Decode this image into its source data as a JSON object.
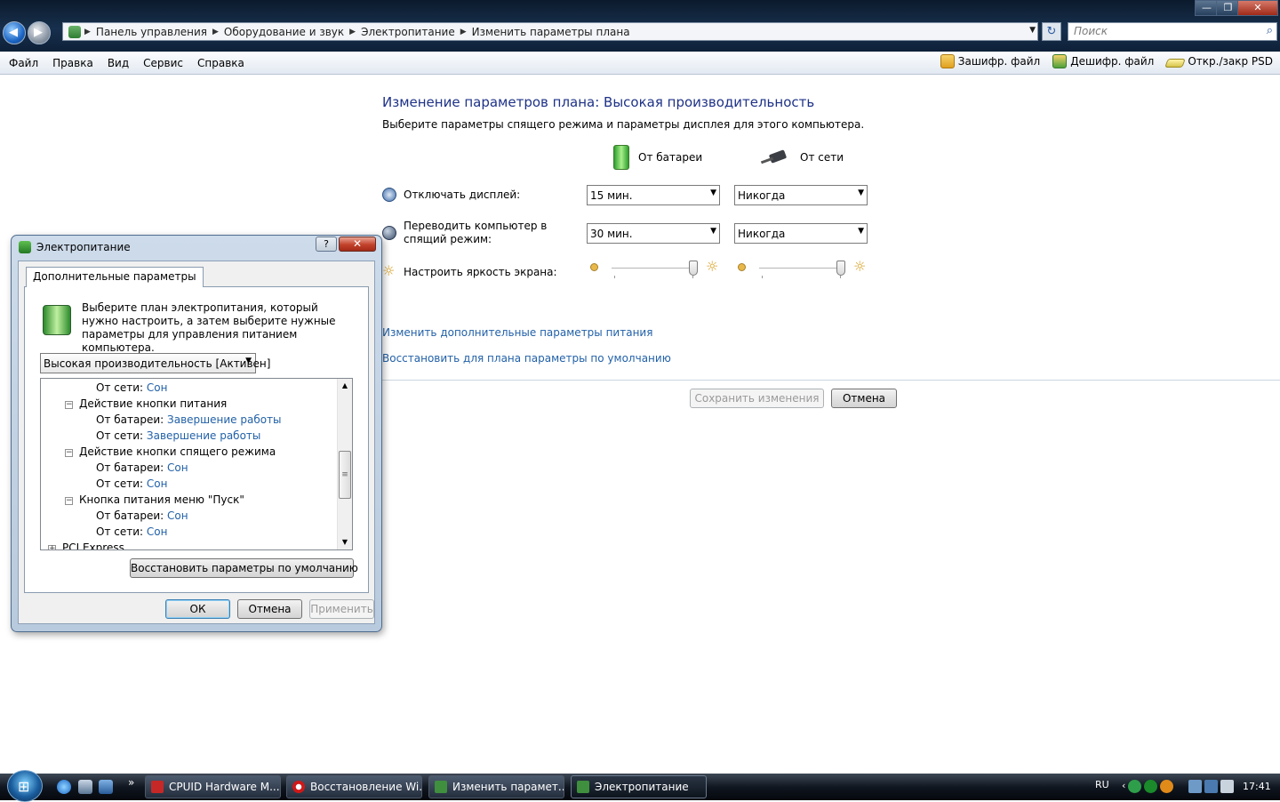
{
  "window": {
    "controls": {
      "minimize": "—",
      "restore": "❐",
      "close": "✕"
    }
  },
  "address": {
    "crumbs": [
      "Панель управления",
      "Оборудование и звук",
      "Электропитание",
      "Изменить параметры плана"
    ],
    "refresh_glyph": "↻",
    "search_placeholder": "Поиск"
  },
  "menu": {
    "items": [
      "Файл",
      "Правка",
      "Вид",
      "Сервис",
      "Справка"
    ],
    "tools": [
      {
        "label": "Зашифр. файл",
        "icon": "lock-encrypt-icon",
        "color": "#e0a020"
      },
      {
        "label": "Дешифр. файл",
        "icon": "lock-decrypt-icon",
        "color": "#4da03a"
      },
      {
        "label": "Откр./закр PSD",
        "icon": "drive-icon",
        "color": "#d8c44a"
      }
    ]
  },
  "plan": {
    "title": "Изменение параметров плана: Высокая производительность",
    "subtitle": "Выберите параметры спящего режима и параметры дисплея для этого компьютера.",
    "col_battery": "От батареи",
    "col_ac": "От сети",
    "rows": [
      {
        "label": "Отключать дисплей:",
        "battery": "15 мин.",
        "ac": "Никогда"
      },
      {
        "label": "Переводить компьютер в спящий режим:",
        "battery": "30 мин.",
        "ac": "Никогда"
      }
    ],
    "brightness_label": "Настроить яркость экрана:",
    "brightness_battery": 1.0,
    "brightness_ac": 1.0,
    "link_advanced": "Изменить дополнительные параметры питания",
    "link_restore": "Восстановить для плана параметры по умолчанию",
    "save_button": "Сохранить изменения",
    "cancel_button": "Отмена"
  },
  "dialog": {
    "title": "Электропитание",
    "help": "?",
    "close": "✕",
    "tab": "Дополнительные параметры",
    "description": "Выберите план электропитания, который нужно настроить, а затем выберите нужные параметры для управления питанием компьютера.",
    "plan_select": "Высокая производительность [Активен]",
    "tree": [
      {
        "label": "От сети:",
        "value": "Сон",
        "level": 2
      },
      {
        "label": "Действие кнопки питания",
        "value": "",
        "level": 1,
        "expander": "−"
      },
      {
        "label": "От батареи:",
        "value": "Завершение работы",
        "level": 2
      },
      {
        "label": "От сети:",
        "value": "Завершение работы",
        "level": 2
      },
      {
        "label": "Действие кнопки спящего режима",
        "value": "",
        "level": 1,
        "expander": "−"
      },
      {
        "label": "От батареи:",
        "value": "Сон",
        "level": 2
      },
      {
        "label": "От сети:",
        "value": "Сон",
        "level": 2
      },
      {
        "label": "Кнопка питания меню \"Пуск\"",
        "value": "",
        "level": 1,
        "expander": "−"
      },
      {
        "label": "От батареи:",
        "value": "Сон",
        "level": 2
      },
      {
        "label": "От сети:",
        "value": "Сон",
        "level": 2
      },
      {
        "label": "PCI Express",
        "value": "",
        "level": 0,
        "expander": "+"
      }
    ],
    "restore_button": "Восстановить параметры по умолчанию",
    "ok_button": "ОК",
    "cancel_button": "Отмена",
    "apply_button": "Применить"
  },
  "taskbar": {
    "start_glyph": "⊞",
    "show_more": "»",
    "tasks": [
      {
        "label": "CPUID Hardware M...",
        "color": "#c62828"
      },
      {
        "label": "Восстановление Wi...",
        "color": "#d01818"
      },
      {
        "label": "Изменить парамет...",
        "color": "#3f8f3f"
      },
      {
        "label": "Электропитание",
        "color": "#3f8f3f"
      }
    ],
    "lang": "RU",
    "tray_arrow": "‹",
    "clock": "17:41"
  }
}
